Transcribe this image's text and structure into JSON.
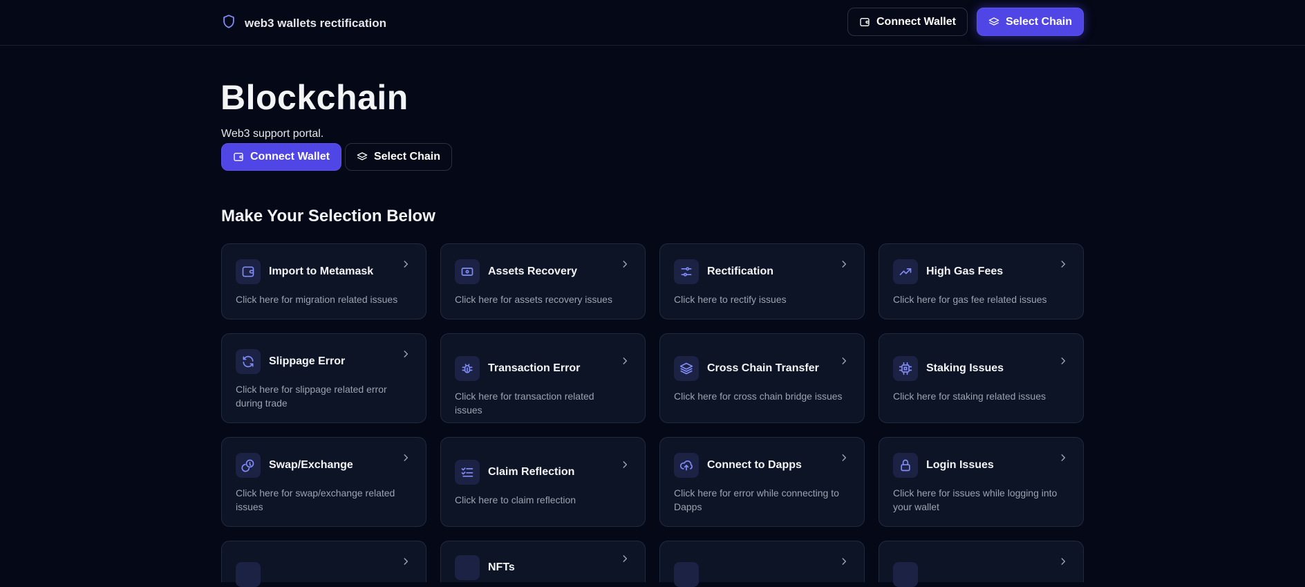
{
  "header": {
    "brand": "web3 wallets rectification",
    "connect_label": "Connect Wallet",
    "select_label": "Select Chain"
  },
  "hero": {
    "title": "Blockchain",
    "subtitle": "Web3 support portal.",
    "connect_label": "Connect Wallet",
    "select_label": "Select Chain"
  },
  "section_title": "Make Your Selection Below",
  "cards": [
    {
      "title": "Import to Metamask",
      "desc": "Click here for migration related issues",
      "icon": "wallet-icon"
    },
    {
      "title": "Assets Recovery",
      "desc": "Click here for assets recovery issues",
      "icon": "banknote-icon"
    },
    {
      "title": "Rectification",
      "desc": "Click here to rectify issues",
      "icon": "sliders-icon"
    },
    {
      "title": "High Gas Fees",
      "desc": "Click here for gas fee related issues",
      "icon": "trending-up-icon"
    },
    {
      "title": "Slippage Error",
      "desc": "Click here for slippage related error during trade",
      "icon": "refresh-icon"
    },
    {
      "title": "Transaction Error",
      "desc": "Click here for transaction related issues",
      "icon": "bug-icon"
    },
    {
      "title": "Cross Chain Transfer",
      "desc": "Click here for cross chain bridge issues",
      "icon": "layers-icon"
    },
    {
      "title": "Staking Issues",
      "desc": "Click here for staking related issues",
      "icon": "cpu-icon"
    },
    {
      "title": "Swap/Exchange",
      "desc": "Click here for swap/exchange related issues",
      "icon": "coins-icon"
    },
    {
      "title": "Claim Reflection",
      "desc": "Click here to claim reflection",
      "icon": "list-checks-icon"
    },
    {
      "title": "Connect to Dapps",
      "desc": "Click here for error while connecting to Dapps",
      "icon": "cloud-upload-icon"
    },
    {
      "title": "Login Issues",
      "desc": "Click here for issues while logging into your wallet",
      "icon": "lock-icon"
    },
    {
      "title": "",
      "desc": "",
      "icon": "partial-icon"
    },
    {
      "title": "NFTs",
      "desc": "",
      "icon": "partial-icon"
    },
    {
      "title": "",
      "desc": "",
      "icon": "partial-icon"
    },
    {
      "title": "",
      "desc": "",
      "icon": "partial-icon"
    }
  ],
  "colors": {
    "background": "#050816",
    "card": "#0d1426",
    "accent": "#5046e5",
    "icon_tint": "#818cf8",
    "muted_text": "#9ca3af"
  }
}
